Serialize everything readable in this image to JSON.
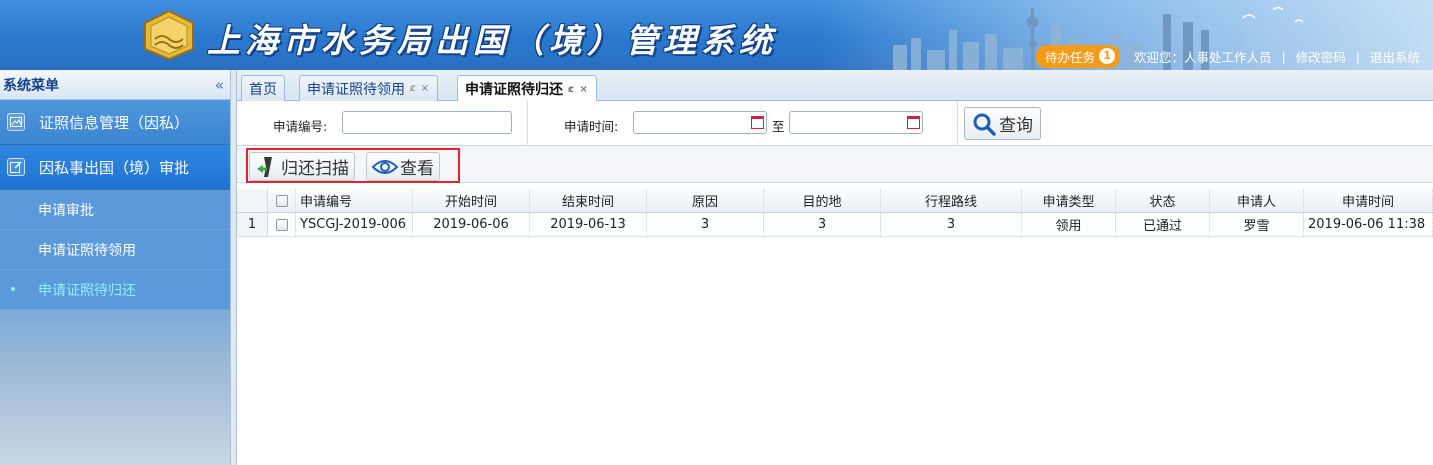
{
  "header": {
    "title": "上海市水务局出国（境）管理系统",
    "todo_label": "待办任务",
    "todo_count": "1",
    "welcome": "欢迎您：人事处工作人员",
    "separator": "|",
    "change_password": "修改密码",
    "logout": "退出系统"
  },
  "sidebar": {
    "title": "系统菜单",
    "collapse_icon": "«",
    "menus": [
      {
        "label": "证照信息管理（因私）",
        "icon": "image-icon"
      },
      {
        "label": "因私事出国（境）审批",
        "icon": "edit-icon"
      }
    ],
    "sub_items": [
      {
        "label": "申请审批"
      },
      {
        "label": "申请证照待领用"
      },
      {
        "label": "申请证照待归还",
        "bullet": "•"
      }
    ]
  },
  "tabs": [
    {
      "label": "首页"
    },
    {
      "label": "申请证照待领用",
      "controls": "ȼ ×"
    },
    {
      "label": "申请证照待归还",
      "controls": "ȼ ×"
    }
  ],
  "search": {
    "app_no_label": "申请编号:",
    "app_no_value": "",
    "time_label": "申请时间:",
    "time_from": "",
    "time_to": "",
    "to_label": "至",
    "search_button": "查询"
  },
  "toolbar": {
    "return_scan": "归还扫描",
    "view": "查看"
  },
  "grid": {
    "columns": [
      "申请编号",
      "开始时间",
      "结束时间",
      "原因",
      "目的地",
      "行程路线",
      "申请类型",
      "状态",
      "申请人",
      "申请时间"
    ],
    "rows": [
      {
        "rownum": "1",
        "cells": [
          "YSCGJ-2019-006",
          "2019-06-06",
          "2019-06-13",
          "3",
          "3",
          "3",
          "领用",
          "已通过",
          "罗雪",
          "2019-06-06 11:38"
        ]
      }
    ]
  },
  "colors": {
    "banner": "#2a79cf",
    "sidebar": "#3f86d4",
    "accent_orange": "#f39c1a",
    "highlight_red": "#e0262b",
    "active_sub": "#8ff0ff"
  }
}
